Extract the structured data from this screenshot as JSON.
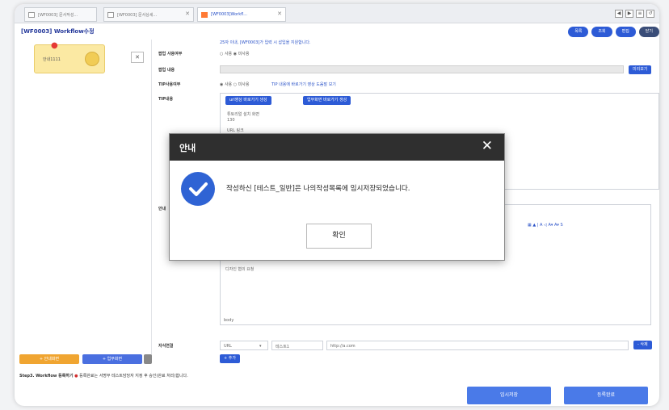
{
  "tabs": [
    {
      "label": "[WF0003] 문서작성..."
    },
    {
      "label": "[WF0003] 문서상세..."
    },
    {
      "label": "[WF0003]Workfl..."
    }
  ],
  "page_title": "[WF0003] Workflow수정",
  "top_buttons": [
    "목록",
    "조회",
    "편집",
    "닫기"
  ],
  "left_panel": {
    "card_label": "안내1111",
    "close_glyph": "✕"
  },
  "form": {
    "top_note": "25자 이내, [WF0003]가 입력 시 삽입을 지원합니다.",
    "rows": [
      {
        "label": "팝업 사용여부",
        "value": "○ 사용  ◉ 미사용"
      },
      {
        "label": "팝업 내용",
        "value": ""
      },
      {
        "label": "TIP사용여부",
        "value": "◉ 사용  ○ 미사용",
        "note": "TIP 내용에 바로가기 영상 도움말 보기"
      },
      {
        "label": "TIP내용",
        "value": ""
      },
      {
        "label": "안내",
        "value": ""
      },
      {
        "label": "자식연결",
        "value": ""
      }
    ],
    "preview_button": "미리보기",
    "tip_buttons": [
      "url영상 바로가기 생성",
      "업무화면 바로가기 생성"
    ],
    "tip_text_lines": [
      "튜토리얼 설치 화면",
      "130",
      "URL 링크"
    ],
    "guide_text": "디자인 협의 요청",
    "body_tag": "body",
    "link_select": "URL",
    "link_name": "테스트1",
    "link_url": "http://a.com",
    "link_add_button": "+ 추가",
    "link_delete_button": "- 삭제"
  },
  "bottom_left_buttons": [
    "+ 안내화면",
    "+ 업무화면"
  ],
  "step_text": "Step3. Workflow 등록하기",
  "step_note": "등록완료는 서명부 테스트담당자 지정 후 승인(완료 처리)합니다.",
  "footer_buttons": [
    "임시저장",
    "등록완료"
  ],
  "modal": {
    "title": "안내",
    "close_glyph": "✕",
    "message": "작성하신 [테스트_일반]은 나의작성목록에 임시저장되었습니다.",
    "ok_label": "확인"
  },
  "colors": {
    "accent": "#2d5bd6",
    "modal_header": "#2f2f2f",
    "success_icon": "#2f63d4",
    "orange": "#f0a531"
  }
}
